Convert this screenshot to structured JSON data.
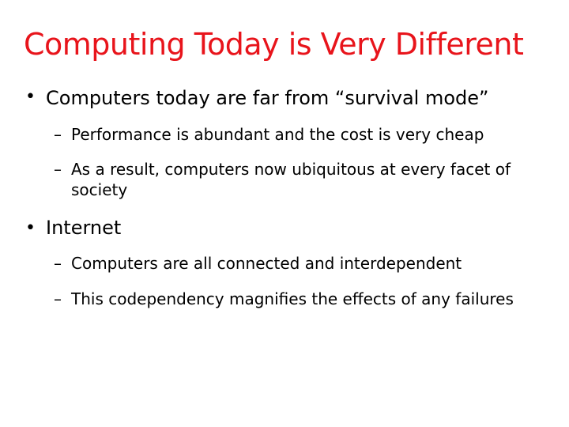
{
  "slide": {
    "title": "Computing Today is Very Different",
    "title_color": "#e8141b",
    "bullets": [
      {
        "marker": "•",
        "text": "Computers today are far from “survival mode”",
        "sub": [
          {
            "marker": "–",
            "text": "Performance is abundant and the cost is very cheap"
          },
          {
            "marker": "–",
            "text": "As a result, computers now ubiquitous at every facet of society"
          }
        ]
      },
      {
        "marker": "•",
        "text": "Internet",
        "sub": [
          {
            "marker": "–",
            "text": "Computers are all connected and interdependent"
          },
          {
            "marker": "–",
            "text": "This codependency magnifies the effects of any failures"
          }
        ]
      }
    ]
  }
}
